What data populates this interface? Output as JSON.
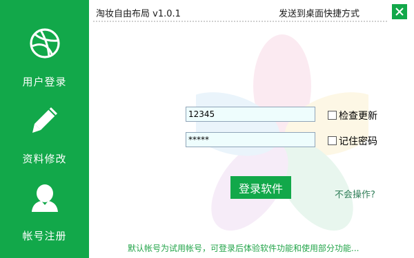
{
  "sidebar": {
    "items": [
      {
        "label": "用户登录",
        "icon": "dribbble-ball-icon"
      },
      {
        "label": "资料修改",
        "icon": "pencil-icon"
      },
      {
        "label": "帐号注册",
        "icon": "user-icon"
      }
    ]
  },
  "titlebar": {
    "title": "淘妆自由布局 v1.0.1",
    "shortcut_link": "发送到桌面快捷方式",
    "close_icon": "close-icon"
  },
  "login": {
    "username": "12345",
    "password": "*****",
    "check_update_label": "检查更新",
    "remember_label": "记住密码",
    "login_button": "登录软件",
    "help_link": "不会操作?"
  },
  "footer": {
    "note": "默认帐号为试用帐号，可登录后体验软件功能和使用部分功能..."
  },
  "colors": {
    "accent": "#12a84a",
    "input_bg": "#eefdfd",
    "footer_text": "#23a54a"
  }
}
